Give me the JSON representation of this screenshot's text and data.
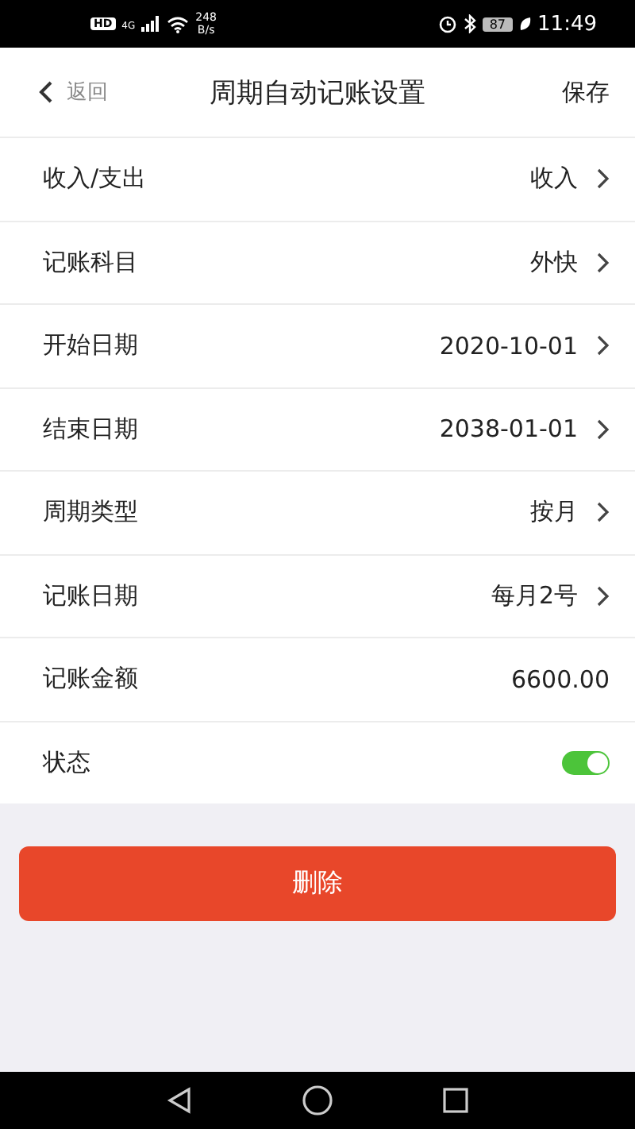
{
  "status_bar": {
    "hd": "HD",
    "network": "4G",
    "speed": "248",
    "speed_unit": "B/s",
    "battery": "87",
    "time": "11:49"
  },
  "header": {
    "back": "返回",
    "title": "周期自动记账设置",
    "action": "保存"
  },
  "rows": [
    {
      "kind": "nav",
      "label": "收入/支出",
      "value": "收入"
    },
    {
      "kind": "nav",
      "label": "记账科目",
      "value": "外快"
    },
    {
      "kind": "nav",
      "label": "开始日期",
      "value": "2020-10-01"
    },
    {
      "kind": "nav",
      "label": "结束日期",
      "value": "2038-01-01"
    },
    {
      "kind": "nav",
      "label": "周期类型",
      "value": "按月"
    },
    {
      "kind": "nav",
      "label": "记账日期",
      "value": "每月2号"
    },
    {
      "kind": "value",
      "label": "记账金额",
      "value": "6600.00"
    },
    {
      "kind": "toggle",
      "label": "状态",
      "on": true
    }
  ],
  "delete_button": "删除"
}
